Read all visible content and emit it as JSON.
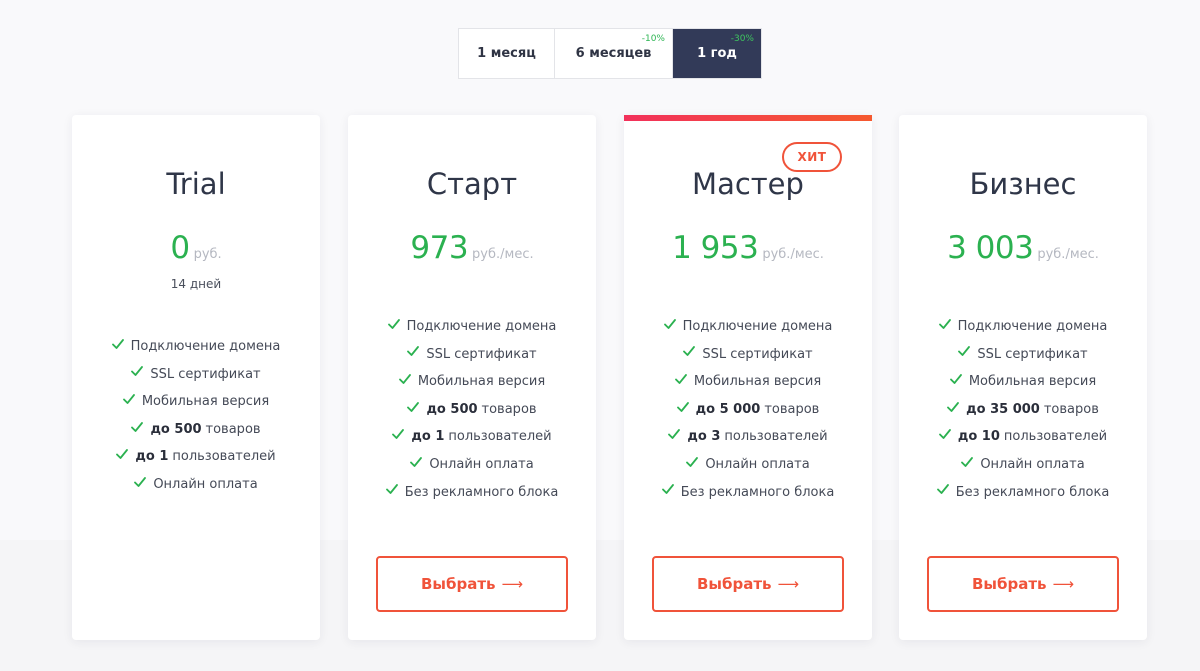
{
  "period_switch": {
    "options": [
      {
        "label": "1 месяц",
        "badge": ""
      },
      {
        "label": "6 месяцев",
        "badge": "-10%"
      },
      {
        "label": "1 год",
        "badge": "-30%"
      }
    ]
  },
  "colors": {
    "accent": "#f0533a",
    "price_green": "#2bb150",
    "active_tab": "#323a58"
  },
  "plans": [
    {
      "title": "Trial",
      "price": "0",
      "unit": "руб.",
      "subtitle": "14 дней",
      "features": [
        {
          "bold": "",
          "text": "Подключение домена"
        },
        {
          "bold": "",
          "text": "SSL сертификат"
        },
        {
          "bold": "",
          "text": "Мобильная версия"
        },
        {
          "bold": "до 500",
          "text": "товаров"
        },
        {
          "bold": "до 1",
          "text": "пользователей"
        },
        {
          "bold": "",
          "text": "Онлайн оплата"
        }
      ]
    },
    {
      "title": "Старт",
      "price": "973",
      "unit": "руб./мес.",
      "features": [
        {
          "bold": "",
          "text": "Подключение домена"
        },
        {
          "bold": "",
          "text": "SSL сертификат"
        },
        {
          "bold": "",
          "text": "Мобильная версия"
        },
        {
          "bold": "до 500",
          "text": "товаров"
        },
        {
          "bold": "до 1",
          "text": "пользователей"
        },
        {
          "bold": "",
          "text": "Онлайн оплата"
        },
        {
          "bold": "",
          "text": "Без рекламного блока"
        }
      ],
      "button": "Выбрать",
      "button_arrow": "⟶"
    },
    {
      "title": "Мастер",
      "badge": "ХИТ",
      "price": "1 953",
      "unit": "руб./мес.",
      "features": [
        {
          "bold": "",
          "text": "Подключение домена"
        },
        {
          "bold": "",
          "text": "SSL сертификат"
        },
        {
          "bold": "",
          "text": "Мобильная версия"
        },
        {
          "bold": "до 5 000",
          "text": "товаров"
        },
        {
          "bold": "до 3",
          "text": "пользователей"
        },
        {
          "bold": "",
          "text": "Онлайн оплата"
        },
        {
          "bold": "",
          "text": "Без рекламного блока"
        }
      ],
      "button": "Выбрать",
      "button_arrow": "⟶"
    },
    {
      "title": "Бизнес",
      "price": "3 003",
      "unit": "руб./мес.",
      "features": [
        {
          "bold": "",
          "text": "Подключение домена"
        },
        {
          "bold": "",
          "text": "SSL сертификат"
        },
        {
          "bold": "",
          "text": "Мобильная версия"
        },
        {
          "bold": "до 35 000",
          "text": "товаров"
        },
        {
          "bold": "до 10",
          "text": "пользователей"
        },
        {
          "bold": "",
          "text": "Онлайн оплата"
        },
        {
          "bold": "",
          "text": "Без рекламного блока"
        }
      ],
      "button": "Выбрать",
      "button_arrow": "⟶"
    }
  ]
}
